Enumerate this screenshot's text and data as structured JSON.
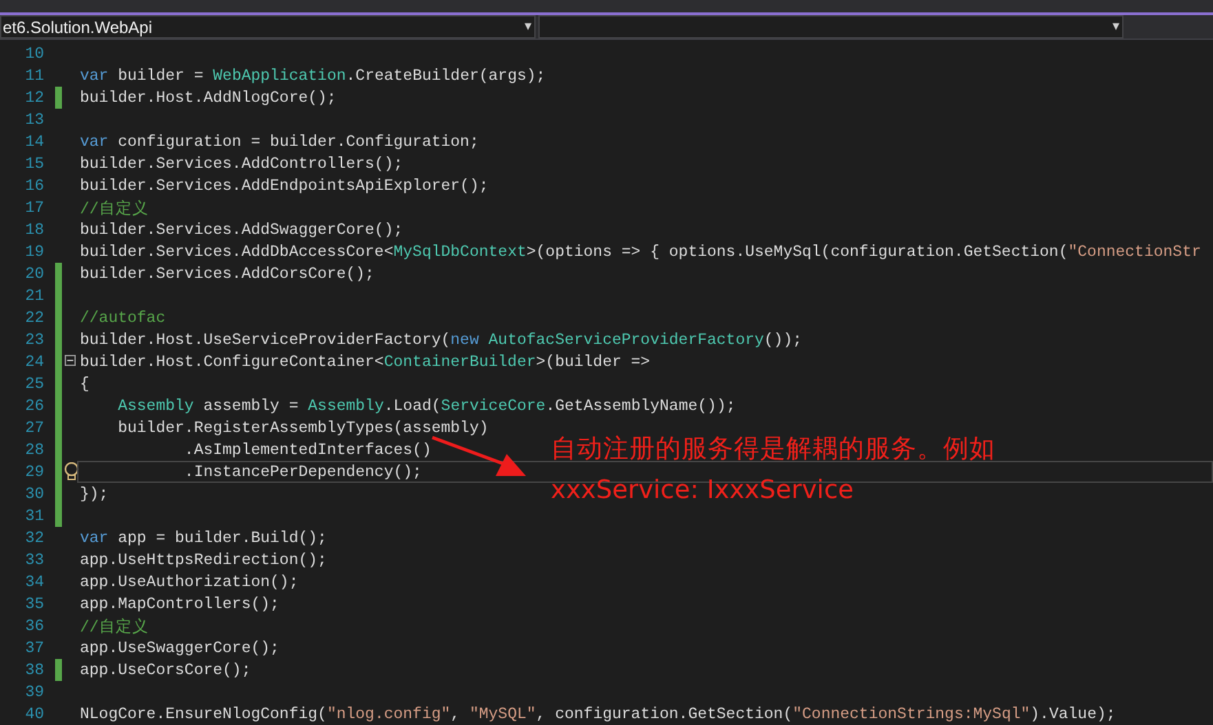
{
  "navigation_bar": {
    "project_dropdown": {
      "value": "et6.Solution.WebApi",
      "caret": "▾"
    },
    "member_dropdown": {
      "caret": "▾"
    }
  },
  "editor": {
    "lines": [
      {
        "number": "10",
        "changed": false,
        "current": false
      },
      {
        "number": "11",
        "changed": false,
        "current": false,
        "tokens": [
          {
            "kind": "kw",
            "text": "var"
          },
          {
            "kind": "plain",
            "text": " builder = "
          },
          {
            "kind": "type",
            "text": "WebApplication"
          },
          {
            "kind": "plain",
            "text": ".CreateBuilder(args);"
          }
        ]
      },
      {
        "number": "12",
        "changed": true,
        "current": false,
        "tokens": [
          {
            "kind": "plain",
            "text": "builder.Host.AddNlogCore();"
          }
        ]
      },
      {
        "number": "13",
        "changed": false,
        "current": false
      },
      {
        "number": "14",
        "changed": false,
        "current": false,
        "tokens": [
          {
            "kind": "kw",
            "text": "var"
          },
          {
            "kind": "plain",
            "text": " configuration = builder.Configuration;"
          }
        ]
      },
      {
        "number": "15",
        "changed": false,
        "current": false,
        "tokens": [
          {
            "kind": "plain",
            "text": "builder.Services.AddControllers();"
          }
        ]
      },
      {
        "number": "16",
        "changed": false,
        "current": false,
        "tokens": [
          {
            "kind": "plain",
            "text": "builder.Services.AddEndpointsApiExplorer();"
          }
        ]
      },
      {
        "number": "17",
        "changed": false,
        "current": false,
        "tokens": [
          {
            "kind": "comment",
            "text": "//自定义"
          }
        ]
      },
      {
        "number": "18",
        "changed": false,
        "current": false,
        "tokens": [
          {
            "kind": "plain",
            "text": "builder.Services.AddSwaggerCore();"
          }
        ]
      },
      {
        "number": "19",
        "changed": false,
        "current": false,
        "tokens": [
          {
            "kind": "plain",
            "text": "builder.Services.AddDbAccessCore<"
          },
          {
            "kind": "type",
            "text": "MySqlDbContext"
          },
          {
            "kind": "plain",
            "text": ">(options => { options.UseMySql(configuration.GetSection("
          },
          {
            "kind": "string",
            "text": "\"ConnectionStr"
          }
        ]
      },
      {
        "number": "20",
        "changed": true,
        "current": false,
        "tokens": [
          {
            "kind": "plain",
            "text": "builder.Services.AddCorsCore();"
          }
        ]
      },
      {
        "number": "21",
        "changed": true,
        "current": false
      },
      {
        "number": "22",
        "changed": true,
        "current": false,
        "tokens": [
          {
            "kind": "comment",
            "text": "//autofac"
          }
        ]
      },
      {
        "number": "23",
        "changed": true,
        "current": false,
        "tokens": [
          {
            "kind": "plain",
            "text": "builder.Host.UseServiceProviderFactory("
          },
          {
            "kind": "kw",
            "text": "new "
          },
          {
            "kind": "type",
            "text": "AutofacServiceProviderFactory"
          },
          {
            "kind": "plain",
            "text": "());"
          }
        ]
      },
      {
        "number": "24",
        "changed": true,
        "current": false,
        "expanded": true,
        "tokens": [
          {
            "kind": "plain",
            "text": "builder.Host.ConfigureContainer<"
          },
          {
            "kind": "type",
            "text": "ContainerBuilder"
          },
          {
            "kind": "plain",
            "text": ">(builder =>"
          }
        ]
      },
      {
        "number": "25",
        "changed": true,
        "current": false,
        "tokens": [
          {
            "kind": "plain",
            "text": "{"
          }
        ]
      },
      {
        "number": "26",
        "changed": true,
        "current": false,
        "tokens": [
          {
            "kind": "type",
            "text": "    Assembly"
          },
          {
            "kind": "plain",
            "text": " assembly = "
          },
          {
            "kind": "type",
            "text": "Assembly"
          },
          {
            "kind": "plain",
            "text": ".Load("
          },
          {
            "kind": "type",
            "text": "ServiceCore"
          },
          {
            "kind": "plain",
            "text": ".GetAssemblyName());"
          }
        ]
      },
      {
        "number": "27",
        "changed": true,
        "current": false,
        "tokens": [
          {
            "kind": "plain",
            "text": "    builder.RegisterAssemblyTypes(assembly)"
          }
        ]
      },
      {
        "number": "28",
        "changed": true,
        "current": false,
        "tokens": [
          {
            "kind": "plain",
            "text": "           .AsImplementedInterfaces()"
          }
        ]
      },
      {
        "number": "29",
        "changed": true,
        "current": true,
        "tokens": [
          {
            "kind": "plain",
            "text": "           .InstancePerDependency();"
          }
        ]
      },
      {
        "number": "30",
        "changed": true,
        "current": false,
        "tokens": [
          {
            "kind": "plain",
            "text": "});"
          }
        ]
      },
      {
        "number": "31",
        "changed": true,
        "current": false
      },
      {
        "number": "32",
        "changed": false,
        "current": false,
        "tokens": [
          {
            "kind": "kw",
            "text": "var"
          },
          {
            "kind": "plain",
            "text": " app = builder.Build();"
          }
        ]
      },
      {
        "number": "33",
        "changed": false,
        "current": false,
        "tokens": [
          {
            "kind": "plain",
            "text": "app.UseHttpsRedirection();"
          }
        ]
      },
      {
        "number": "34",
        "changed": false,
        "current": false,
        "tokens": [
          {
            "kind": "plain",
            "text": "app.UseAuthorization();"
          }
        ]
      },
      {
        "number": "35",
        "changed": false,
        "current": false,
        "tokens": [
          {
            "kind": "plain",
            "text": "app.MapControllers();"
          }
        ]
      },
      {
        "number": "36",
        "changed": false,
        "current": false,
        "tokens": [
          {
            "kind": "comment",
            "text": "//自定义"
          }
        ]
      },
      {
        "number": "37",
        "changed": false,
        "current": false,
        "tokens": [
          {
            "kind": "plain",
            "text": "app.UseSwaggerCore();"
          }
        ]
      },
      {
        "number": "38",
        "changed": true,
        "current": false,
        "tokens": [
          {
            "kind": "plain",
            "text": "app.UseCorsCore();"
          }
        ]
      },
      {
        "number": "39",
        "changed": false,
        "current": false
      },
      {
        "number": "40",
        "changed": false,
        "current": false,
        "tokens": [
          {
            "kind": "plain",
            "text": "NLogCore.EnsureNlogConfig("
          },
          {
            "kind": "string",
            "text": "\"nlog.config\""
          },
          {
            "kind": "plain",
            "text": ", "
          },
          {
            "kind": "string",
            "text": "\"MySQL\""
          },
          {
            "kind": "plain",
            "text": ", configuration.GetSection("
          },
          {
            "kind": "string",
            "text": "\"ConnectionStrings:MySql\""
          },
          {
            "kind": "plain",
            "text": ").Value);"
          }
        ]
      }
    ]
  },
  "annotation": {
    "lines": [
      "自动注册的服务得是解耦的服务。例如",
      "xxxService: IxxxService"
    ]
  }
}
